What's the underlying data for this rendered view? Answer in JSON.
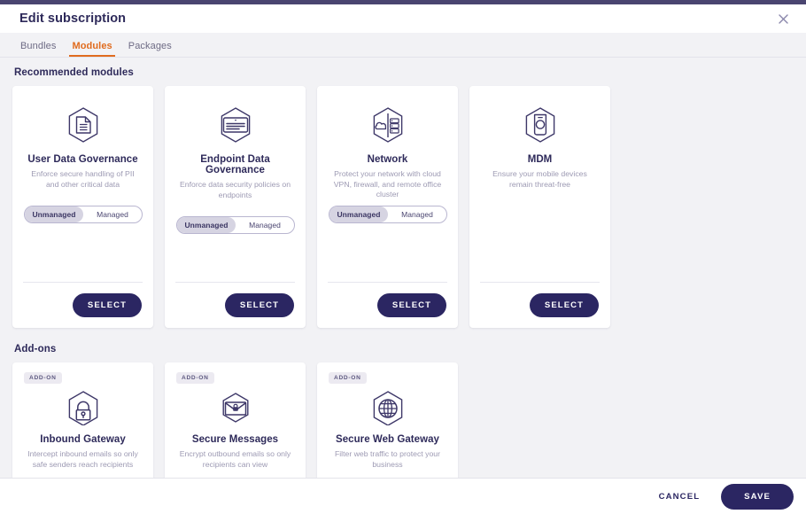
{
  "header": {
    "title": "Edit subscription",
    "close_icon": "close-icon"
  },
  "tabs": [
    {
      "label": "Bundles",
      "active": false
    },
    {
      "label": "Modules",
      "active": true
    },
    {
      "label": "Packages",
      "active": false
    }
  ],
  "sections": {
    "modules": {
      "title": "Recommended modules",
      "cards": [
        {
          "icon": "document-hexagon-icon",
          "title": "User Data Governance",
          "description": "Enforce secure handling of PII and other critical data",
          "toggle": {
            "options": [
              "Unmanaged",
              "Managed"
            ],
            "selected": "Unmanaged"
          },
          "select_label": "SELECT"
        },
        {
          "icon": "endpoint-screen-hexagon-icon",
          "title": "Endpoint Data Governance",
          "description": "Enforce data security policies on endpoints",
          "toggle": {
            "options": [
              "Unmanaged",
              "Managed"
            ],
            "selected": "Unmanaged"
          },
          "select_label": "SELECT"
        },
        {
          "icon": "cloud-server-hexagon-icon",
          "title": "Network",
          "description": "Protect your network with cloud VPN, firewall, and remote office cluster",
          "toggle": {
            "options": [
              "Unmanaged",
              "Managed"
            ],
            "selected": "Unmanaged"
          },
          "select_label": "SELECT"
        },
        {
          "icon": "mobile-device-hexagon-icon",
          "title": "MDM",
          "description": "Ensure your mobile devices remain threat-free",
          "toggle": null,
          "select_label": "SELECT"
        }
      ]
    },
    "addons": {
      "title": "Add-ons",
      "badge_label": "ADD-ON",
      "cards": [
        {
          "icon": "lock-hexagon-icon",
          "title": "Inbound Gateway",
          "description": "Intercept inbound emails so only safe senders reach recipients"
        },
        {
          "icon": "envelope-lock-hexagon-icon",
          "title": "Secure Messages",
          "description": "Encrypt outbound emails so only recipients can view"
        },
        {
          "icon": "globe-hexagon-icon",
          "title": "Secure Web Gateway",
          "description": "Filter web traffic to protect your business"
        }
      ]
    }
  },
  "footer": {
    "cancel_label": "CANCEL",
    "save_label": "SAVE"
  },
  "colors": {
    "accent_orange": "#e06c1f",
    "primary_navy": "#2b2662",
    "topbar_purple": "#4a4570",
    "muted_text": "#9d9ab3",
    "toggle_selected_bg": "#d6d4e2"
  }
}
